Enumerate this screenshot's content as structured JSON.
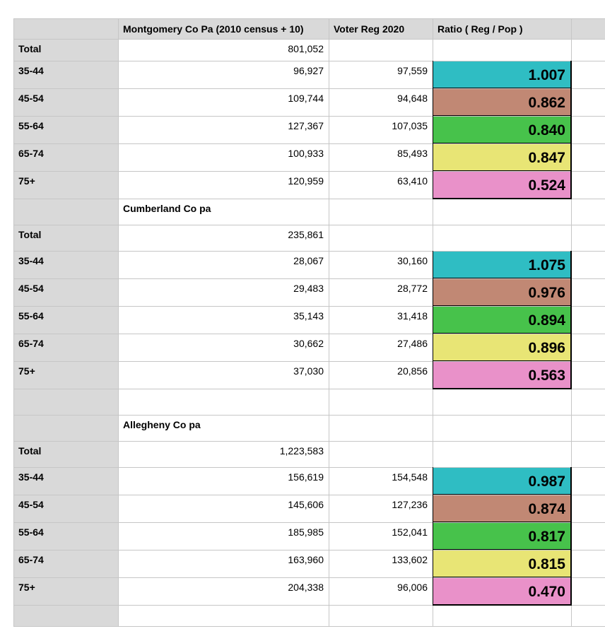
{
  "header": {
    "col_a": "",
    "col_b": "Montgomery  Co Pa (2010 census + 10)",
    "col_c": "Voter Reg 2020",
    "col_d": "Ratio   ( Reg / Pop )"
  },
  "colors": {
    "header_gray": "#d9d9d9",
    "row_label_gray": "#d9d9d9",
    "gridline": "#c6c6c6",
    "age_35_44": "#2fbdc3",
    "age_45_54": "#c18874",
    "age_55_64": "#47c24b",
    "age_65_74": "#e8e575",
    "age_75_plus": "#e991c9"
  },
  "rows": [
    {
      "type": "total",
      "label": "Total",
      "population": "801,052",
      "voter_reg": "",
      "ratio": ""
    },
    {
      "type": "age",
      "label": "35-44",
      "population": "96,927",
      "voter_reg": "97,559",
      "ratio": "1.007",
      "color": "#2fbdc3"
    },
    {
      "type": "age",
      "label": "45-54",
      "population": "109,744",
      "voter_reg": "94,648",
      "ratio": "0.862",
      "color": "#c18874"
    },
    {
      "type": "age",
      "label": "55-64",
      "population": "127,367",
      "voter_reg": "107,035",
      "ratio": "0.840",
      "color": "#47c24b"
    },
    {
      "type": "age",
      "label": "65-74",
      "population": "100,933",
      "voter_reg": "85,493",
      "ratio": "0.847",
      "color": "#e8e575"
    },
    {
      "type": "age",
      "label": "75+",
      "population": "120,959",
      "voter_reg": "63,410",
      "ratio": "0.524",
      "color": "#e991c9"
    },
    {
      "type": "county",
      "label": "",
      "county": "Cumberland Co pa"
    },
    {
      "type": "total",
      "label": "Total",
      "population": "235,861",
      "voter_reg": "",
      "ratio": ""
    },
    {
      "type": "age",
      "label": "35-44",
      "population": "28,067",
      "voter_reg": "30,160",
      "ratio": "1.075",
      "color": "#2fbdc3"
    },
    {
      "type": "age",
      "label": "45-54",
      "population": "29,483",
      "voter_reg": "28,772",
      "ratio": "0.976",
      "color": "#c18874"
    },
    {
      "type": "age",
      "label": "55-64",
      "population": "35,143",
      "voter_reg": "31,418",
      "ratio": "0.894",
      "color": "#47c24b"
    },
    {
      "type": "age",
      "label": "65-74",
      "population": "30,662",
      "voter_reg": "27,486",
      "ratio": "0.896",
      "color": "#e8e575"
    },
    {
      "type": "age",
      "label": "75+",
      "population": "37,030",
      "voter_reg": "20,856",
      "ratio": "0.563",
      "color": "#e991c9"
    },
    {
      "type": "blank",
      "label": ""
    },
    {
      "type": "county",
      "label": "",
      "county": "Allegheny Co pa"
    },
    {
      "type": "total",
      "label": "Total",
      "population": "1,223,583",
      "voter_reg": "",
      "ratio": ""
    },
    {
      "type": "age",
      "label": "35-44",
      "population": "156,619",
      "voter_reg": "154,548",
      "ratio": "0.987",
      "color": "#2fbdc3"
    },
    {
      "type": "age",
      "label": "45-54",
      "population": "145,606",
      "voter_reg": "127,236",
      "ratio": "0.874",
      "color": "#c18874"
    },
    {
      "type": "age",
      "label": "55-64",
      "population": "185,985",
      "voter_reg": "152,041",
      "ratio": "0.817",
      "color": "#47c24b"
    },
    {
      "type": "age",
      "label": "65-74",
      "population": "163,960",
      "voter_reg": "133,602",
      "ratio": "0.815",
      "color": "#e8e575"
    },
    {
      "type": "age",
      "label": "75+",
      "population": "204,338",
      "voter_reg": "96,006",
      "ratio": "0.470",
      "color": "#e991c9"
    },
    {
      "type": "blank",
      "label": ""
    }
  ]
}
